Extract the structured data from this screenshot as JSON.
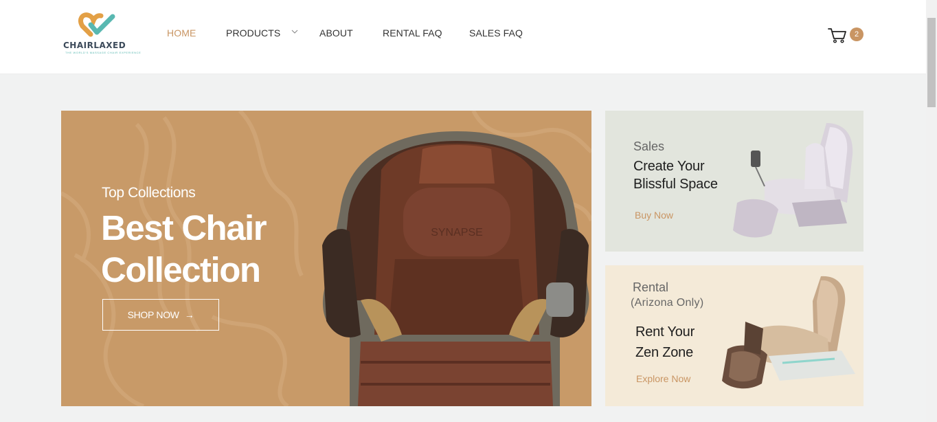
{
  "brand": {
    "name": "CHAIRLAXED",
    "tagline": "THE WORLD'S MASSAGE CHAIR EXPERIENCE"
  },
  "nav": {
    "items": [
      {
        "label": "HOME",
        "active": true
      },
      {
        "label": "PRODUCTS",
        "has_dropdown": true
      },
      {
        "label": "ABOUT"
      },
      {
        "label": "RENTAL FAQ"
      },
      {
        "label": "SALES FAQ"
      }
    ]
  },
  "cart": {
    "count": "2",
    "icon": "cart-icon"
  },
  "hero": {
    "eyebrow": "Top Collections",
    "title": "Best Chair Collection",
    "button_label": "SHOP NOW",
    "button_icon": "arrow-right-icon",
    "chair_brand": "SYNAPSE"
  },
  "promos": {
    "sales": {
      "label": "Sales",
      "headline_line1": "Create Your",
      "headline_line2": "Blissful Space",
      "cta": "Buy Now"
    },
    "rental": {
      "label": "Rental",
      "sub": "(Arizona Only)",
      "headline_line1": "Rent Your",
      "headline_line2": "Zen Zone",
      "cta": "Explore Now"
    }
  },
  "colors": {
    "accent": "#c99563",
    "hero_bg": "#c89a68",
    "sales_bg": "#e2e5dd",
    "rental_bg": "#f4ead8",
    "logo_teal": "#59b8b1",
    "logo_orange": "#e3a046",
    "page_bg": "#f1f2f2"
  }
}
